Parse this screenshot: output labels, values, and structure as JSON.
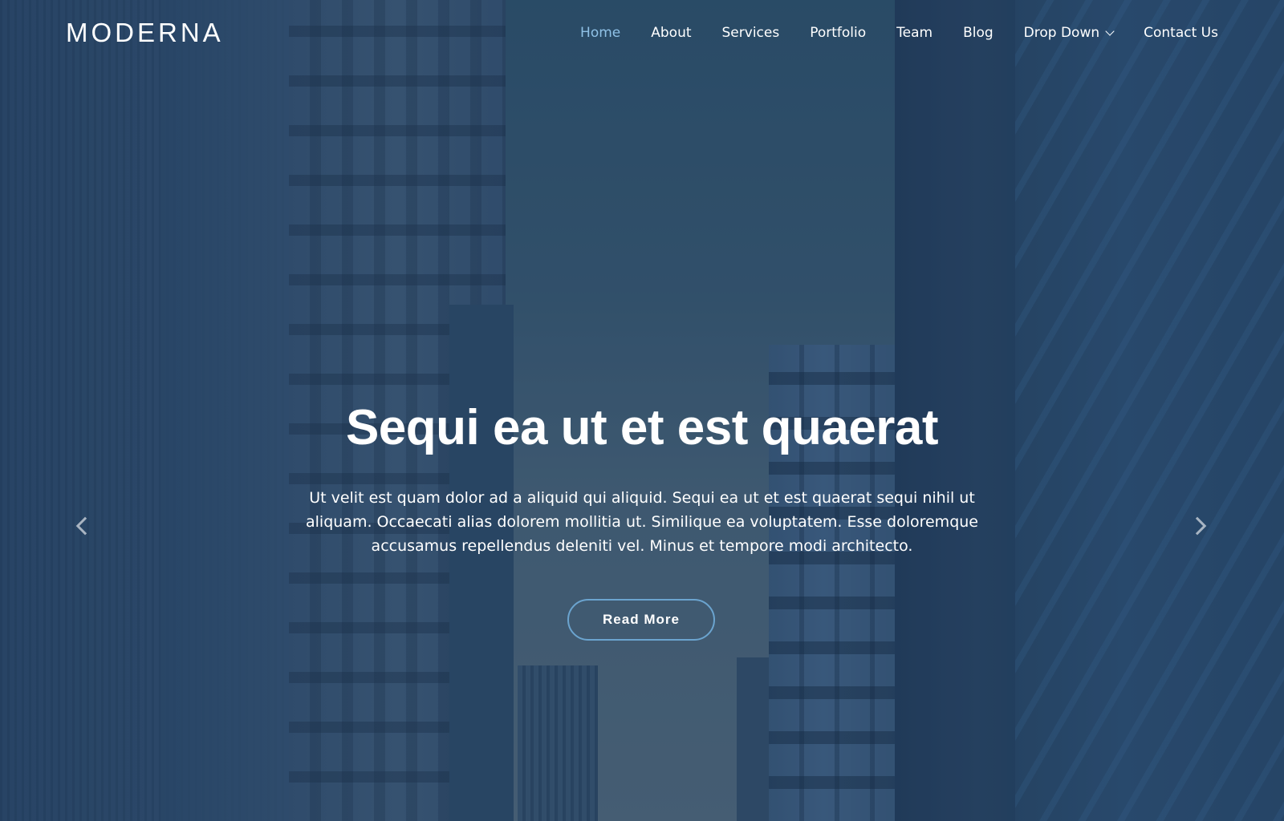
{
  "brand": {
    "logo_text": "MODERNA"
  },
  "nav": {
    "items": [
      {
        "label": "Home",
        "active": true
      },
      {
        "label": "About"
      },
      {
        "label": "Services"
      },
      {
        "label": "Portfolio"
      },
      {
        "label": "Team"
      },
      {
        "label": "Blog"
      },
      {
        "label": "Drop Down",
        "has_dropdown": true
      },
      {
        "label": "Contact Us"
      }
    ],
    "active_color": "#8fc1e6"
  },
  "hero": {
    "title": "Sequi ea ut et est quaerat",
    "text": "Ut velit est quam dolor ad a aliquid qui aliquid. Sequi ea ut et est quaerat sequi nihil ut aliquam. Occaecati alias dolorem mollitia ut. Similique ea voluptatem. Esse doloremque accusamus repellendus deleniti vel. Minus et tempore modi architecto.",
    "button_label": "Read More",
    "button_border_color": "#6ba4cf",
    "prev_icon": "chevron-left-icon",
    "next_icon": "chevron-right-icon"
  }
}
